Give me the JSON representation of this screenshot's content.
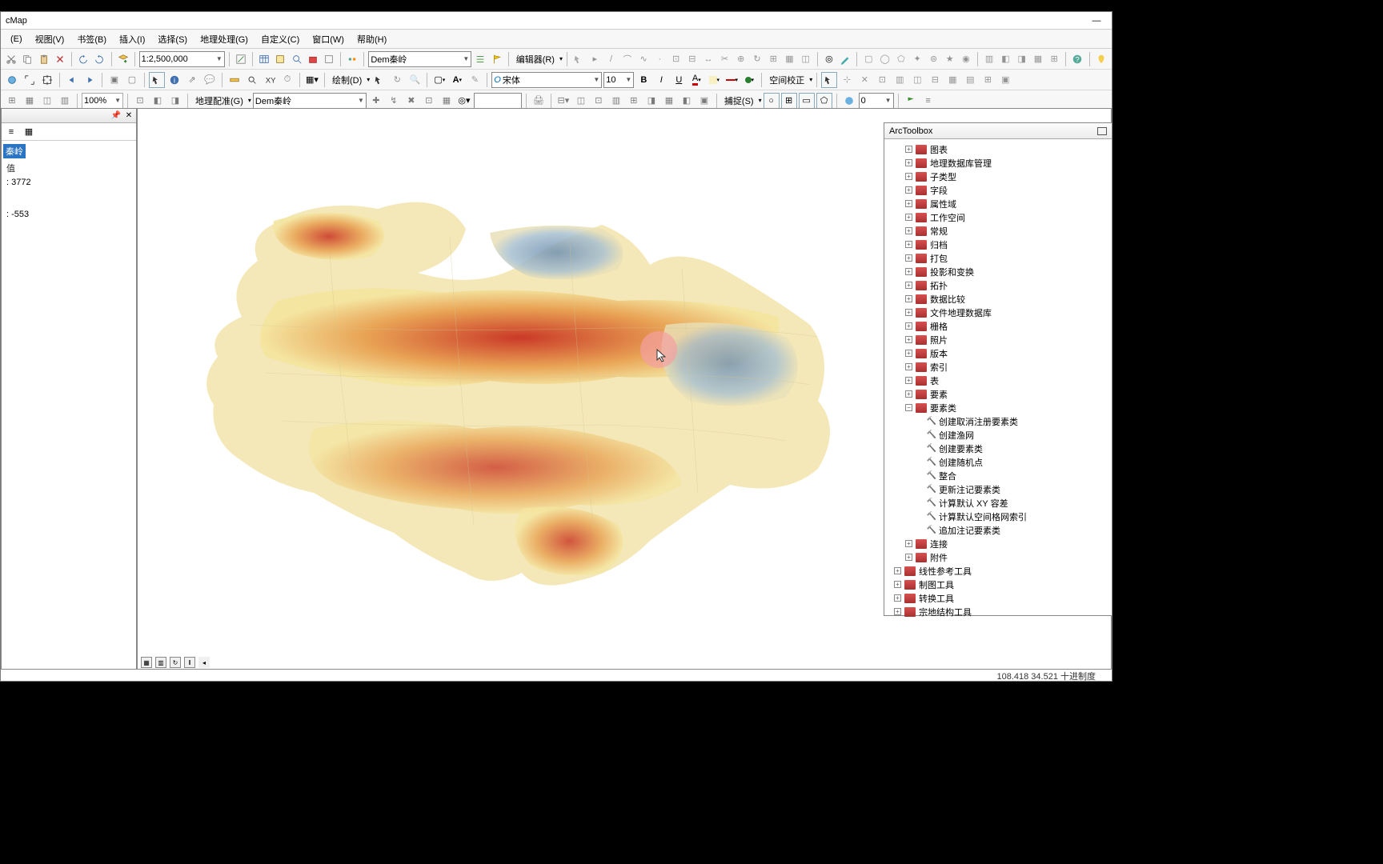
{
  "titlebar": {
    "title": "cMap"
  },
  "menubar": [
    "(E)",
    "视图(V)",
    "书签(B)",
    "插入(I)",
    "选择(S)",
    "地理处理(G)",
    "自定义(C)",
    "窗口(W)",
    "帮助(H)"
  ],
  "tb1": {
    "scale": "1:2,500,000",
    "layer_combo": "Dem秦岭"
  },
  "tb2": {
    "draw_label": "绘制(D)",
    "font_combo": "宋体",
    "size_combo": "10",
    "spatial_adj": "空间校正"
  },
  "tb3": {
    "zoom": "100%",
    "georef_label": "地理配准(G)",
    "georef_combo": "Dem秦岭",
    "snap_label": "捕捉(S)",
    "snap_num": "0"
  },
  "editor": {
    "label": "编辑器(R)"
  },
  "toc": {
    "layer": "秦岭",
    "high": ": 3772",
    "low": ": -553"
  },
  "arctoolbox": {
    "title": "ArcToolbox",
    "nodes": [
      "图表",
      "地理数据库管理",
      "子类型",
      "字段",
      "属性域",
      "工作空间",
      "常规",
      "归档",
      "打包",
      "投影和变换",
      "拓扑",
      "数据比较",
      "文件地理数据库",
      "栅格",
      "照片",
      "版本",
      "索引",
      "表",
      "要素",
      "要素类"
    ],
    "tools": [
      "创建取消注册要素类",
      "创建渔网",
      "创建要素类",
      "创建随机点",
      "整合",
      "更新注记要素类",
      "计算默认 XY 容差",
      "计算默认空间格网索引",
      "追加注记要素类"
    ],
    "nodes2": [
      "连接",
      "附件"
    ],
    "nodes3": [
      "线性参考工具",
      "制图工具",
      "转换工具",
      "宗地结构工具"
    ]
  },
  "status": {
    "coords": "108.418  34.521 十进制度"
  }
}
